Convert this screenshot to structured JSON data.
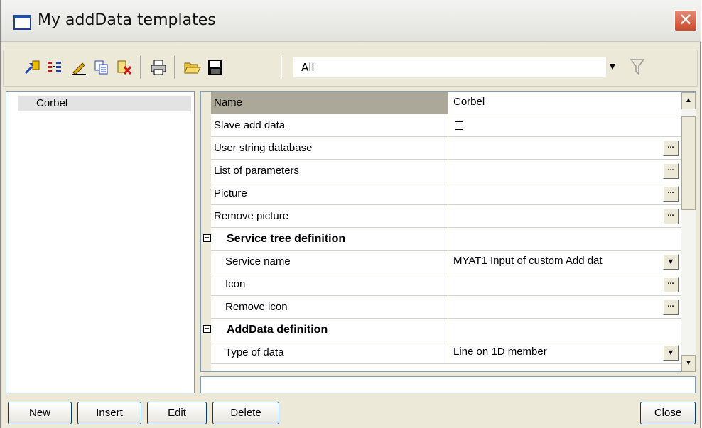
{
  "window": {
    "title": "My addData templates"
  },
  "toolbar": {
    "icons": [
      "import-icon",
      "columns-icon",
      "edit-pencil-icon",
      "copy-icon",
      "delete-icon",
      "printer-icon",
      "open-folder-icon",
      "save-icon",
      "filter-icon"
    ],
    "filter_value": "All"
  },
  "left_list": {
    "items": [
      "Corbel"
    ]
  },
  "properties": {
    "name": {
      "label": "Name",
      "value": "Corbel"
    },
    "slave_add_data": {
      "label": "Slave add data",
      "checked": false
    },
    "user_string_database": {
      "label": "User string database",
      "value": ""
    },
    "list_of_parameters": {
      "label": "List of parameters",
      "value": ""
    },
    "picture": {
      "label": "Picture",
      "value": ""
    },
    "remove_picture": {
      "label": "Remove picture",
      "value": ""
    },
    "service_tree_category": {
      "label": "Service tree definition"
    },
    "service_name": {
      "label": "Service name",
      "value": "MYAT1 Input of custom Add dat"
    },
    "icon": {
      "label": "Icon",
      "value": ""
    },
    "remove_icon": {
      "label": "Remove icon",
      "value": ""
    },
    "adddata_category": {
      "label": "AddData definition"
    },
    "type_of_data": {
      "label": "Type of data",
      "value": "Line on 1D member"
    },
    "ellipsis": "..."
  },
  "buttons": {
    "new": "New",
    "insert": "Insert",
    "edit": "Edit",
    "delete": "Delete",
    "close": "Close"
  }
}
